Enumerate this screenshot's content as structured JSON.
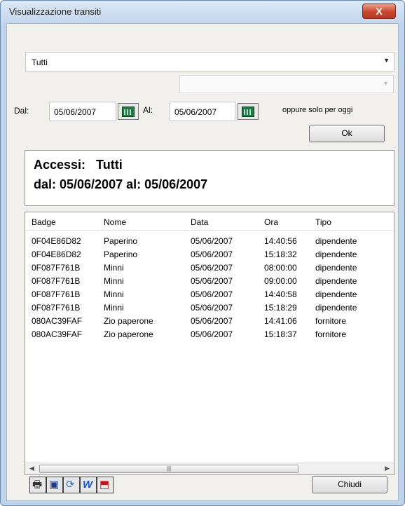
{
  "window": {
    "title": "Visualizzazione transiti",
    "close_glyph": "X"
  },
  "filter": {
    "selected": "Tutti",
    "sub_selected": ""
  },
  "dates": {
    "from_label": "Dal:",
    "from_value": "05/06/2007",
    "to_label": "Al:",
    "to_value": "05/06/2007",
    "today_label": "oppure solo per oggi"
  },
  "ok_button": "Ok",
  "info": {
    "line1": "Accessi:   Tutti",
    "line2": "dal: 05/06/2007 al: 05/06/2007"
  },
  "list": {
    "columns": [
      "Badge",
      "Nome",
      "Data",
      "Ora",
      "Tipo"
    ],
    "rows": [
      [
        "0F04E86D82",
        "Paperino",
        "05/06/2007",
        "14:40:56",
        "dipendente"
      ],
      [
        "0F04E86D82",
        "Paperino",
        "05/06/2007",
        "15:18:32",
        "dipendente"
      ],
      [
        "0F087F761B",
        "Minni",
        "05/06/2007",
        "08:00:00",
        "dipendente"
      ],
      [
        "0F087F761B",
        "Minni",
        "05/06/2007",
        "09:00:00",
        "dipendente"
      ],
      [
        "0F087F761B",
        "Minni",
        "05/06/2007",
        "14:40:58",
        "dipendente"
      ],
      [
        "0F087F761B",
        "Minni",
        "05/06/2007",
        "15:18:29",
        "dipendente"
      ],
      [
        "080AC39FAF",
        "Zio paperone",
        "05/06/2007",
        "14:41:06",
        "fornitore"
      ],
      [
        "080AC39FAF",
        "Zio paperone",
        "05/06/2007",
        "15:18:37",
        "fornitore"
      ]
    ]
  },
  "toolbar": {
    "icons": [
      "printer-icon",
      "monitor-icon",
      "refresh-icon",
      "word-icon",
      "pdf-icon"
    ],
    "glyphs": [
      "🖶",
      "▣",
      "⟳",
      "W",
      "⬒"
    ],
    "icon_colors": [
      "#333333",
      "#1b3a8a",
      "#2a6fb0",
      "#1b58b8",
      "#c4161c"
    ]
  },
  "close_button": "Chiudi"
}
